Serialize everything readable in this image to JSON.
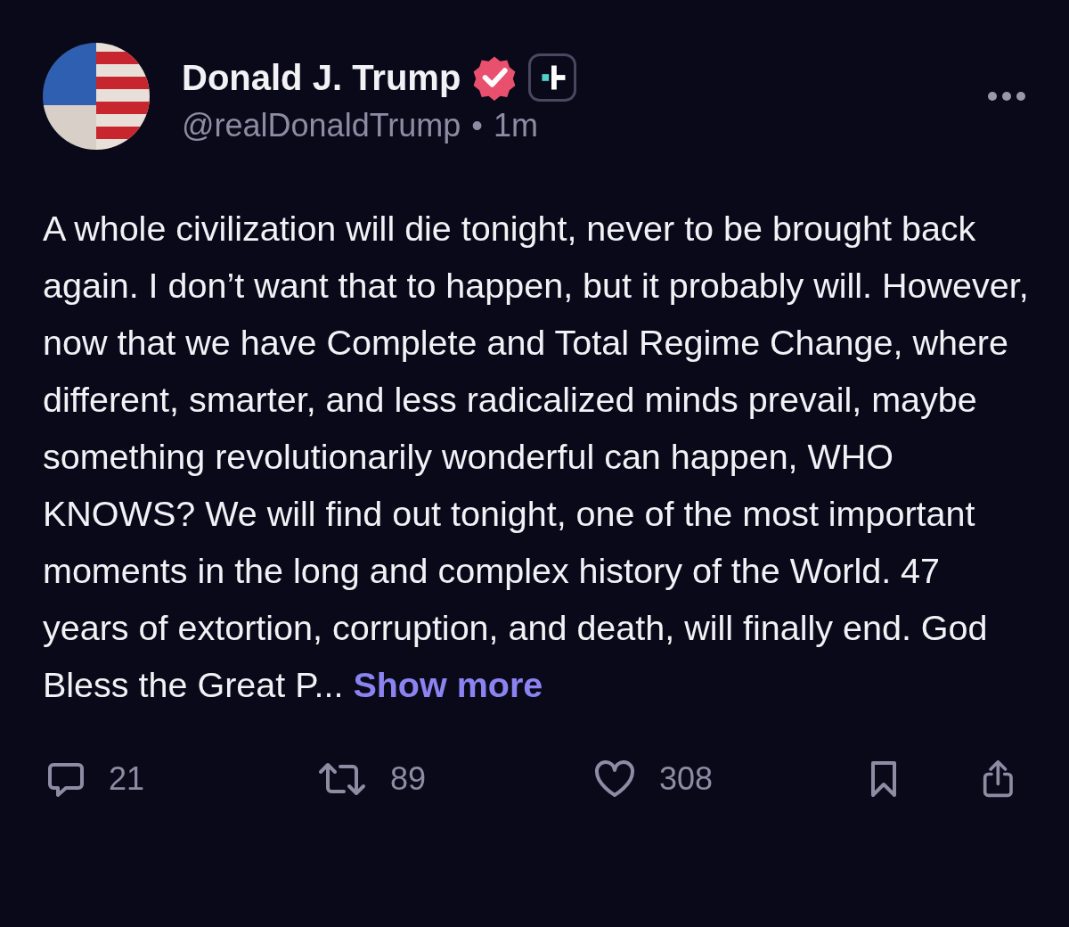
{
  "author": {
    "name": "Donald J. Trump",
    "verified": true,
    "subscriber": true,
    "handle": "@realDonaldTrump",
    "separator": "•",
    "time": "1m"
  },
  "post": {
    "text": "A whole civilization will die tonight, never to be brought back again. I don’t want that to happen, but it probably will. However, now that we have Complete and Total Regime Change, where different, smarter, and less radicalized minds prevail, maybe something revolutionarily wonderful can happen, WHO KNOWS? We will find out tonight, one of the most important moments in the long and complex history of the World. 47 years of extortion, corruption, and death, will finally end. God Bless the Great P...",
    "more_link": "Show more"
  },
  "actions": [
    {
      "kind": "reply",
      "count": "21"
    },
    {
      "kind": "repost",
      "count": "89"
    },
    {
      "kind": "like",
      "count": "308"
    },
    {
      "kind": "bookmark"
    },
    {
      "kind": "share"
    }
  ]
}
